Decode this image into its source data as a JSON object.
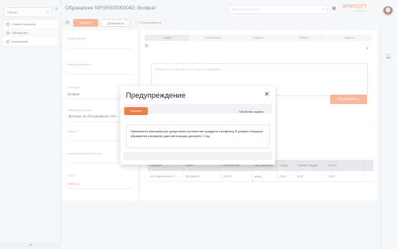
{
  "nav": {
    "portal": "Портал",
    "items": [
      {
        "label": "Главная страница",
        "icon": "home-icon"
      },
      {
        "label": "Обращения",
        "icon": "alert-icon"
      },
      {
        "label": "База знаний",
        "icon": "book-icon"
      }
    ],
    "bottom_arrow": "◂"
  },
  "header": {
    "title": "Обращение NPSR000000043: Возврат",
    "search_placeholder": "Выполнить команду",
    "logo": "BPMSOFT",
    "logo_sub": "СТАНДАРТ"
  },
  "toolbar": {
    "close": "Закрыть",
    "actions": "Действия",
    "complain": "Пожаловаться"
  },
  "form": {
    "reaction_time_label": "Время реакции",
    "resolve_time_label": "Время разрешения",
    "category_label": "Категория*",
    "category_value": "Возврат",
    "service_contract_label": "Сервисный договор",
    "service_contract_value": "\"Договор на обслуживание почт...",
    "service_label": "Сервис",
    "config_unit_label": "Конфигурационная единица",
    "deal_label": "Заказ",
    "deal_value": "ORD-16"
  },
  "stages": [
    "Новое",
    "Согласование",
    "В работе",
    "Решено",
    "Закрыто"
  ],
  "message_placeholder": "Оставьте сообщение для Службы поддержки",
  "publish": "Опубликовать",
  "table": {
    "headers": [
      "Продукт",
      "Цена",
      "Количество",
      "Ед. измерен...",
      "Скид...",
      "Сумма скидки",
      "Итого"
    ],
    "rows": [
      [
        "OC Astra Linux S...",
        "45 600,00",
        "10,00",
        "штук",
        "0,00",
        "0,00",
        "0,00"
      ]
    ]
  },
  "modal": {
    "title": "Предупреждение",
    "apply": "Принять",
    "task_props": "Свойства задачи",
    "message": "Превышено максимально допустимое количество продукта к возврату. В рамках текущего обращения к возврату данной позиции доступно: 2 ед."
  }
}
